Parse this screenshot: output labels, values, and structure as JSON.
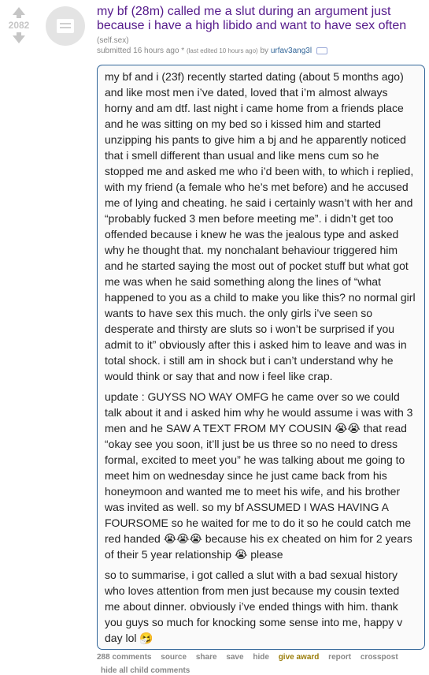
{
  "post": {
    "score": "2082",
    "title": "my bf (28m) called me a slut during an argument just because i have a high libido and want to have sex often",
    "domain": "(self.sex)",
    "submitted": "submitted 16 hours ago",
    "edited_mark": " * ",
    "edited": "(last edited 10 hours ago)",
    "by": " by ",
    "author": "urfav3ang3l",
    "body": [
      "my bf and i (23f) recently started dating (about 5 months ago) and like most men i’ve dated, loved that i’m almost always horny and am dtf. last night i came home from a friends place and he was sitting on my bed so i kissed him and started unzipping his pants to give him a bj and he apparently noticed that i smell different than usual and like mens cum so he stopped me and asked me who i’d been with, to which i replied, with my friend (a female who he’s met before) and he accused me of lying and cheating. he said i certainly wasn’t with her and “probably fucked 3 men before meeting me”. i didn’t get too offended because i knew he was the jealous type and asked why he thought that. my nonchalant behaviour triggered him and he started saying the most out of pocket stuff but what got me was when he said something along the lines of “what happened to you as a child to make you like this? no normal girl wants to have sex this much. the only girls i’ve seen so desperate and thirsty are sluts so i won’t be surprised if you admit to it” obviously after this i asked him to leave and was in total shock. i still am in shock but i can’t understand why he would think or say that and now i feel like crap.",
      "update : GUYSS NO WAY OMFG he came over so we could talk about it and i asked him why he would assume i was with 3 men and he SAW A TEXT FROM MY COUSIN 😭😭 that read “okay see you soon, it’ll just be us three so no need to dress formal, excited to meet you” he was talking about me going to meet him on wednesday since he just came back from his honeymoon and wanted me to meet his wife, and his brother was invited as well. so my bf ASSUMED I WAS HAVING A FOURSOME so he waited for me to do it so he could catch me red handed 😭😭😭 because his ex cheated on him for 2 years of their 5 year relationship 😭 please",
      "so to summarise, i got called a slut with a bad sexual history who loves attention from men just because my cousin texted me about dinner. obviously i’ve ended things with him. thank you guys so much for knocking some sense into me, happy v day lol 🤧"
    ]
  },
  "buttons": {
    "comments": "288 comments",
    "source": "source",
    "share": "share",
    "save": "save",
    "hide": "hide",
    "give_award": "give award",
    "report": "report",
    "crosspost": "crosspost",
    "hide_all": "hide all child comments"
  },
  "colors": {
    "title": "#551a8b",
    "author": "#336699",
    "border": "#336699",
    "gold": "#9a7d0a"
  }
}
